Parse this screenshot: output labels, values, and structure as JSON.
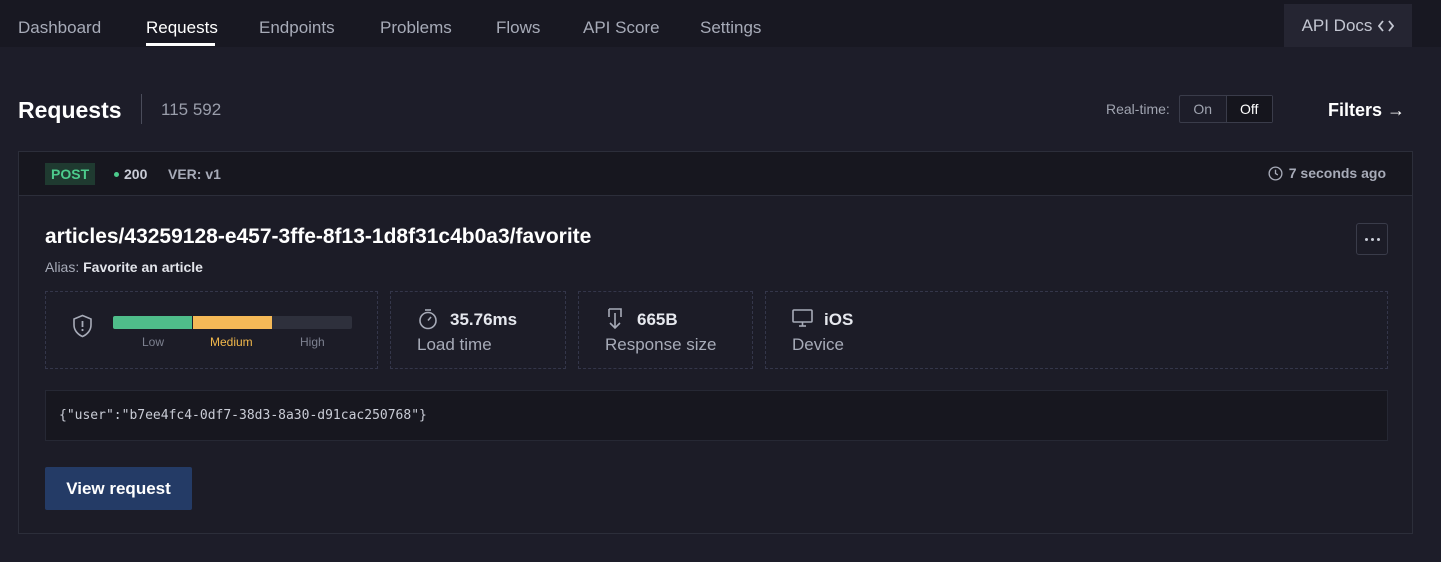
{
  "nav": {
    "items": [
      {
        "label": "Dashboard",
        "active": false
      },
      {
        "label": "Requests",
        "active": true
      },
      {
        "label": "Endpoints",
        "active": false
      },
      {
        "label": "Problems",
        "active": false
      },
      {
        "label": "Flows",
        "active": false
      },
      {
        "label": "API Score",
        "active": false
      },
      {
        "label": "Settings",
        "active": false
      }
    ],
    "api_docs": {
      "label": "API Docs",
      "icon": "code-icon"
    }
  },
  "header": {
    "title": "Requests",
    "count": "115 592",
    "realtime": {
      "label": "Real-time:",
      "on_label": "On",
      "off_label": "Off",
      "selected": "Off"
    },
    "filters_label": "Filters →"
  },
  "request": {
    "method": "POST",
    "status": "200",
    "version": "VER: v1",
    "time_ago": "7 seconds ago",
    "endpoint": "articles/43259128-e457-3ffe-8f13-1d8f31c4b0a3/favorite",
    "alias_label": "Alias:",
    "alias": "Favorite an article",
    "risk": {
      "labels": [
        "Low",
        "Medium",
        "High"
      ],
      "level": "Medium",
      "colors": [
        "#4fbd8a",
        "#f5b957",
        "#2e303c"
      ]
    },
    "load_time": {
      "value": "35.76ms",
      "caption": "Load time"
    },
    "response_size": {
      "value": "665B",
      "caption": "Response size"
    },
    "device": {
      "value": "iOS",
      "caption": "Device"
    },
    "payload": "{\"user\":\"b7ee4fc4-0df7-38d3-8a30-d91cac250768\"}",
    "view_button": "View request"
  },
  "colors": {
    "background": "#1d1d29",
    "nav_background": "#181822",
    "method_green": "#4ccb8c",
    "primary_button": "#243b66",
    "risk_medium": "#f2b84b"
  }
}
